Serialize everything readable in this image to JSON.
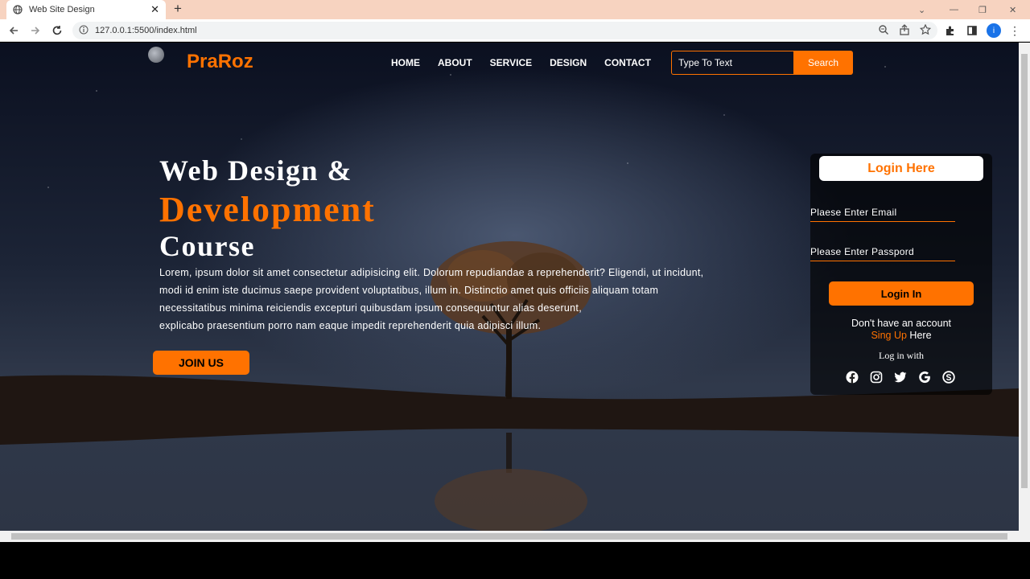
{
  "browser": {
    "tab_title": "Web Site Design",
    "url": "127.0.0.1:5500/index.html",
    "profile_initial": "i"
  },
  "header": {
    "logo": "PraRoz",
    "menu": [
      "HOME",
      "ABOUT",
      "SERVICE",
      "DESIGN",
      "CONTACT"
    ],
    "search_placeholder": "Type To Text",
    "search_button": "Search"
  },
  "hero": {
    "line1": "Web Design &",
    "line2": "Development",
    "line3": "Course",
    "paragraph_lines": [
      "Lorem, ipsum dolor sit amet consectetur adipisicing elit. Dolorum repudiandae a reprehenderit? Eligendi, ut incidunt,",
      "modi id enim iste ducimus saepe provident voluptatibus, illum in. Distinctio amet quis officiis aliquam totam",
      "necessitatibus minima reiciendis excepturi quibusdam ipsum consequuntur alias deserunt,",
      "explicabo praesentium porro nam eaque impedit reprehenderit quia adipisci illum."
    ],
    "join_button": "JOIN US"
  },
  "login": {
    "title": "Login Here",
    "email_placeholder": "Plaese Enter Email",
    "password_placeholder": "Please Enter Passpord",
    "button": "Login In",
    "no_account": "Don't have an account",
    "signup_link": "Sing Up",
    "signup_suffix": " Here",
    "login_with": "Log in with",
    "socials": [
      "facebook-icon",
      "instagram-icon",
      "twitter-icon",
      "google-icon",
      "skype-icon"
    ]
  },
  "colors": {
    "accent": "#ff7200"
  }
}
